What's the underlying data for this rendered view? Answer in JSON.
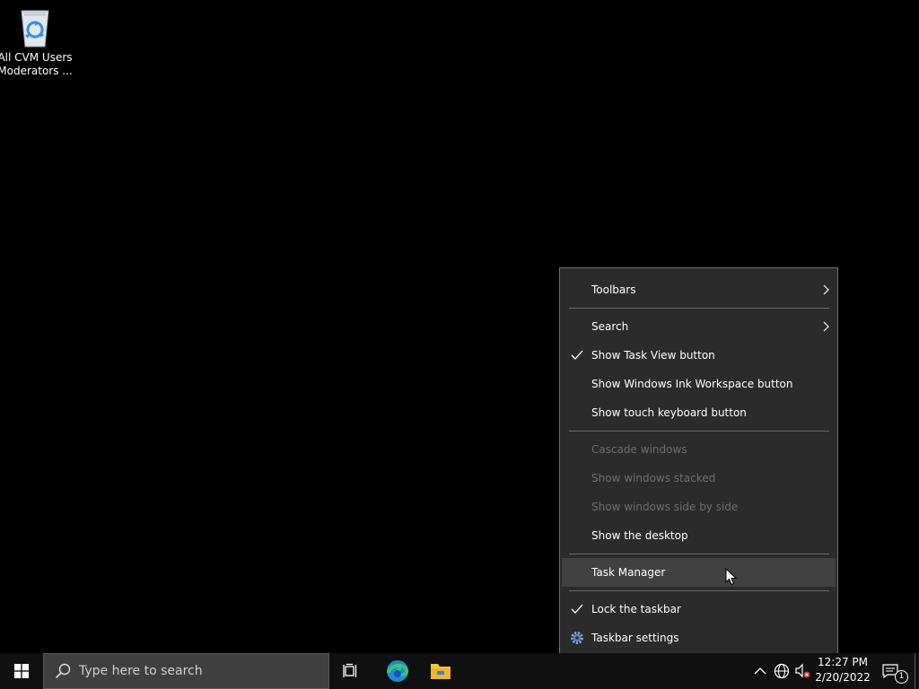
{
  "desktop": {
    "icons": [
      {
        "label_line1": "All CVM Users",
        "label_line2": "Moderators ...",
        "icon": "recycle-bin-icon"
      }
    ]
  },
  "context_menu": {
    "items": [
      {
        "label": "Toolbars",
        "has_submenu": true
      },
      {
        "label": "Search",
        "has_submenu": true
      },
      {
        "label": "Show Task View button",
        "checked": true
      },
      {
        "label": "Show Windows Ink Workspace button"
      },
      {
        "label": "Show touch keyboard button"
      },
      {
        "label": "Cascade windows",
        "disabled": true
      },
      {
        "label": "Show windows stacked",
        "disabled": true
      },
      {
        "label": "Show windows side by side",
        "disabled": true
      },
      {
        "label": "Show the desktop"
      },
      {
        "label": "Task Manager",
        "hovered": true
      },
      {
        "label": "Lock the taskbar",
        "checked": true
      },
      {
        "label": "Taskbar settings",
        "icon": "gear-icon"
      }
    ]
  },
  "taskbar": {
    "search_placeholder": "Type here to search",
    "pinned": [
      "task-view-icon",
      "edge-icon",
      "file-explorer-icon"
    ],
    "tray": [
      "chevron-up-icon",
      "network-icon",
      "volume-muted-icon"
    ],
    "clock_time": "12:27 PM",
    "clock_date": "2/20/2022",
    "notification_count": "1"
  },
  "colors": {
    "desktop_bg": "#000000",
    "menu_bg": "#2b2b2b",
    "menu_hover": "#414141",
    "taskbar_bg": "#101010",
    "search_bg": "#3f3f3f",
    "edge_blue": "#1f8ad8",
    "edge_green": "#3ec46d",
    "folder_yellow": "#f5c443"
  }
}
